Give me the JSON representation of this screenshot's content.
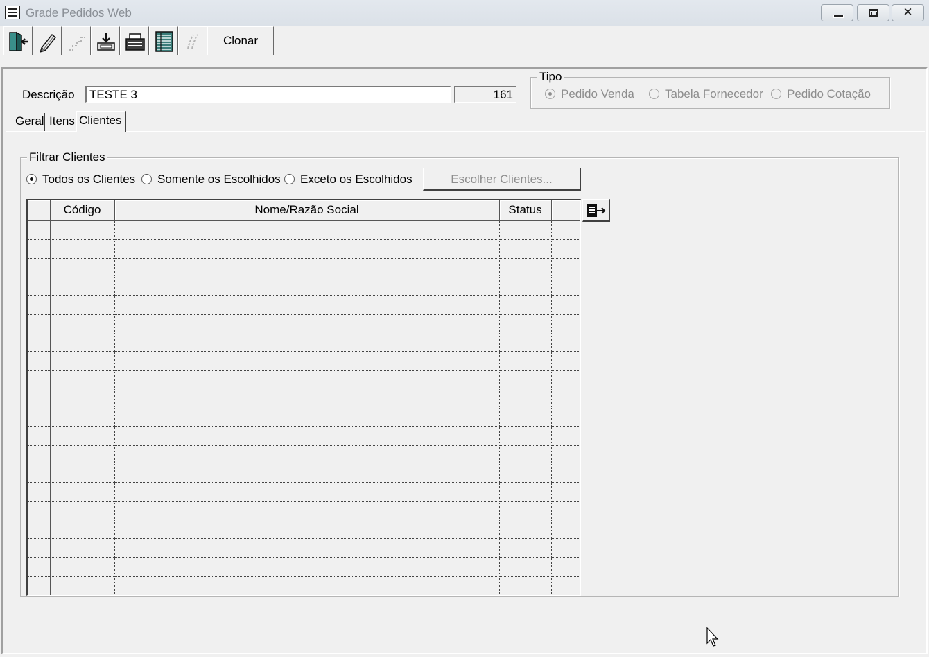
{
  "window": {
    "title": "Grade Pedidos Web"
  },
  "toolbar": {
    "buttons": [
      {
        "icon": "exit-door-icon"
      },
      {
        "icon": "edit-pencil-icon"
      },
      {
        "icon": "steps-icon",
        "disabled": true
      },
      {
        "icon": "save-disk-icon"
      },
      {
        "icon": "open-folder-icon"
      },
      {
        "icon": "grid-list-icon"
      },
      {
        "icon": "signature-icon",
        "disabled": true
      }
    ],
    "clonar_label": "Clonar"
  },
  "form": {
    "descricao_label": "Descrição",
    "descricao_value": "TESTE 3",
    "code_value": "161"
  },
  "tipo": {
    "caption": "Tipo",
    "options": [
      {
        "label": "Pedido Venda",
        "selected": true
      },
      {
        "label": "Tabela Fornecedor",
        "selected": false
      },
      {
        "label": "Pedido Cotação",
        "selected": false
      }
    ],
    "disabled": true
  },
  "tabs": [
    {
      "label": "Geral",
      "active": false
    },
    {
      "label": "Itens",
      "active": false
    },
    {
      "label": "Clientes",
      "active": true
    }
  ],
  "filtrar": {
    "caption": "Filtrar Clientes",
    "options": [
      {
        "label": "Todos os Clientes",
        "selected": true
      },
      {
        "label": "Somente os Escolhidos",
        "selected": false
      },
      {
        "label": "Exceto os Escolhidos",
        "selected": false
      }
    ],
    "escolher_label": "Escolher Clientes..."
  },
  "grid": {
    "columns": [
      "Código",
      "Nome/Razão Social",
      "Status"
    ],
    "rows": []
  },
  "colors": {
    "background": "#f0f0f0",
    "disabled_text": "#8d8d8d",
    "titlebar": "#dbe1e8"
  }
}
